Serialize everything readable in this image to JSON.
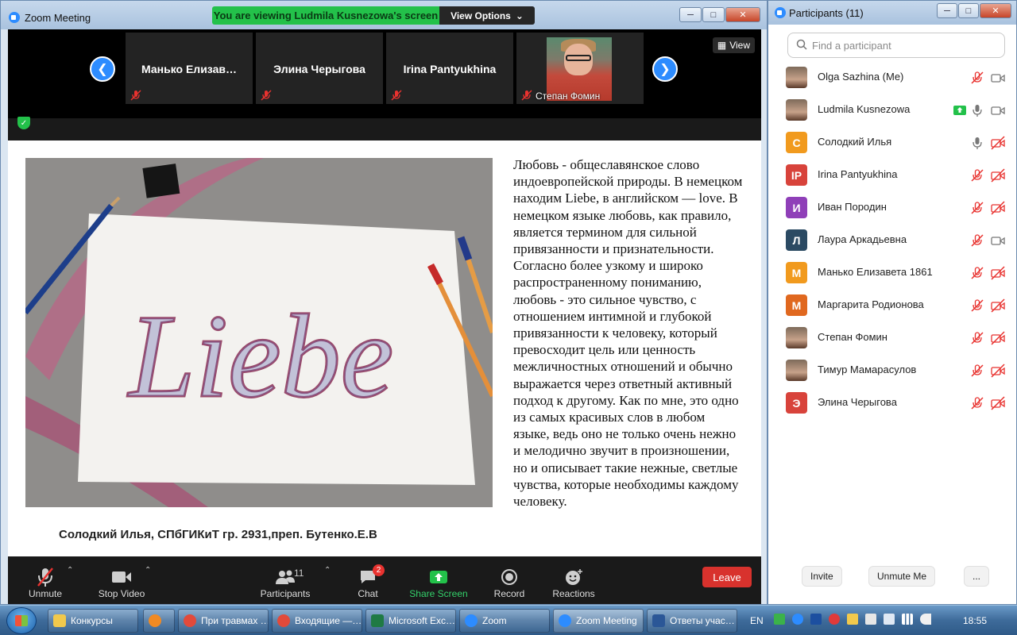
{
  "meeting_window": {
    "title": "Zoom Meeting",
    "share_banner": "You are viewing Ludmila Kusnezowa's screen",
    "view_options_label": "View Options",
    "view_label": "View"
  },
  "thumbnails": [
    {
      "name": "Манько  Елизав…"
    },
    {
      "name": "Элина Черыгова"
    },
    {
      "name": "Irina Pantyukhina"
    },
    {
      "name": "Степан Фомин"
    }
  ],
  "shared_slide": {
    "paragraph": "Любовь - общеславянское слово индоевропейской природы. В немецком находим Liebe, в английском — love. В немецком языке любовь, как правило, является термином для сильной привязанности и признательности. Согласно более узкому и широко распространенному пониманию, любовь - это сильное чувство, с отношением интимной и глубокой привязанности к человеку, который превосходит цель или ценность межличностных отношений и обычно выражается через ответный активный подход к другому. Как по мне, это одно из самых красивых слов в любом языке, ведь оно не только очень нежно и мелодично звучит в произношении, но и описывает такие нежные, светлые чувства, которые необходимы каждому человеку.",
    "caption": "Солодкий Илья,  СПбГИКиТ гр. 2931,преп. Бутенко.Е.В"
  },
  "toolbar": {
    "unmute": "Unmute",
    "stop_video": "Stop Video",
    "participants": "Participants",
    "participants_count": "11",
    "chat": "Chat",
    "chat_badge": "2",
    "share_screen": "Share Screen",
    "record": "Record",
    "reactions": "Reactions",
    "leave": "Leave"
  },
  "participants_panel": {
    "title": "Participants (11)",
    "search_placeholder": "Find a participant",
    "items": [
      {
        "name": "Olga Sazhina (Me)",
        "avatar": "",
        "avatar_color": "",
        "mic": "muted",
        "cam": "on"
      },
      {
        "name": "Ludmila Kusnezowa",
        "avatar": "",
        "avatar_color": "",
        "mic": "on",
        "cam": "on",
        "sharing": true
      },
      {
        "name": "Солодкий Илья",
        "avatar": "С",
        "avatar_color": "#f19a1e",
        "mic": "on",
        "cam": "off"
      },
      {
        "name": "Irina Pantyukhina",
        "avatar": "IP",
        "avatar_color": "#d8433b",
        "mic": "muted",
        "cam": "off"
      },
      {
        "name": "Иван Породин",
        "avatar": "И",
        "avatar_color": "#8f3fb8",
        "mic": "muted",
        "cam": "off"
      },
      {
        "name": "Лаура Аркадьевна",
        "avatar": "Л",
        "avatar_color": "#2b4a63",
        "mic": "muted",
        "cam": "on"
      },
      {
        "name": "Манько Елизавета 1861",
        "avatar": "М",
        "avatar_color": "#f19a1e",
        "mic": "muted",
        "cam": "off"
      },
      {
        "name": "Маргарита Родионова",
        "avatar": "М",
        "avatar_color": "#e0681f",
        "mic": "muted",
        "cam": "off"
      },
      {
        "name": "Степан Фомин",
        "avatar": "",
        "avatar_color": "",
        "mic": "muted",
        "cam": "off"
      },
      {
        "name": "Тимур Мамарасулов",
        "avatar": "",
        "avatar_color": "",
        "mic": "muted",
        "cam": "off"
      },
      {
        "name": "Элина Черыгова",
        "avatar": "Э",
        "avatar_color": "#d8433b",
        "mic": "muted",
        "cam": "off"
      }
    ],
    "invite": "Invite",
    "unmute_me": "Unmute Me",
    "more": "..."
  },
  "taskbar": {
    "items": [
      {
        "label": "Конкурсы",
        "icon": "folder-icon"
      },
      {
        "label": "",
        "icon": "app-icon"
      },
      {
        "label": "При травмах …",
        "icon": "chrome-icon"
      },
      {
        "label": "Входящие —…",
        "icon": "chrome-icon"
      },
      {
        "label": "Microsoft Exc…",
        "icon": "excel-icon"
      },
      {
        "label": "Zoom",
        "icon": "zoom-icon"
      },
      {
        "label": "Zoom Meeting",
        "icon": "zoom-icon"
      },
      {
        "label": "Ответы учас…",
        "icon": "word-icon"
      }
    ],
    "language": "EN",
    "clock": "18:55"
  }
}
